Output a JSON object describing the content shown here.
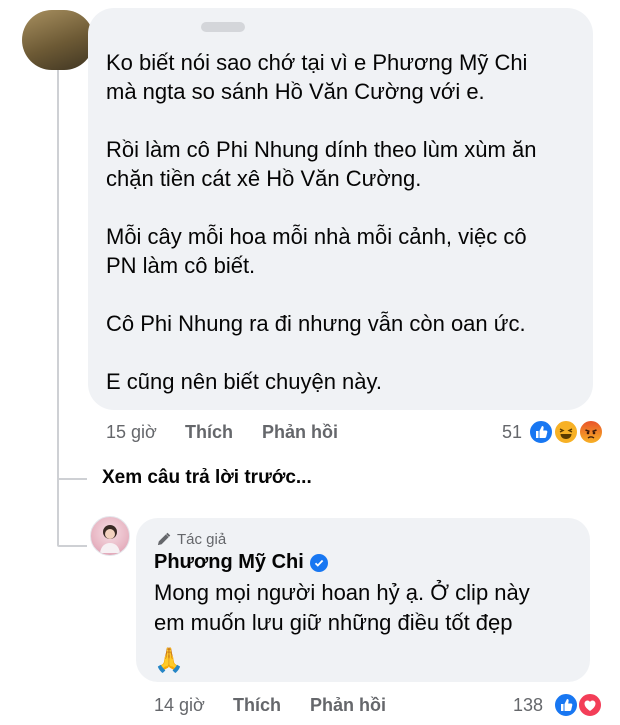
{
  "comment1": {
    "author_blurred": true,
    "paragraphs": [
      "Ko biết nói sao chớ tại vì e Phương Mỹ Chi\nmà ngta so sánh Hồ Văn Cường với e.",
      "Rồi làm cô Phi Nhung dính theo lùm xùm ăn\nchặn tiền cát xê Hồ Văn Cường.",
      "Mỗi cây mỗi hoa mỗi nhà mỗi cảnh, việc cô\nPN làm cô biết.",
      "Cô Phi Nhung ra đi nhưng vẫn còn oan ức.",
      "E cũng nên biết chuyện này."
    ],
    "time": "15 giờ",
    "like_label": "Thích",
    "reply_label": "Phản hồi",
    "reaction_count": "51",
    "reactions": [
      "like-icon",
      "haha-icon",
      "angry-icon"
    ]
  },
  "view_previous": "Xem câu trả lời trước...",
  "reply": {
    "author_badge": "Tác giả",
    "author_name": "Phương Mỹ Chi",
    "text": "Mong mọi người hoan hỷ ạ. Ở clip này\nem muốn lưu giữ những điều tốt đẹp",
    "emoji": "🙏",
    "time": "14 giờ",
    "like_label": "Thích",
    "reply_label": "Phản hồi",
    "reaction_count": "138",
    "reactions": [
      "like-icon",
      "love-icon"
    ]
  },
  "colors": {
    "bubble": "#f0f2f5",
    "secondary_text": "#65676b",
    "like_blue": "#1877f2",
    "love_red": "#f33e58",
    "haha_yellow": "#f7b125"
  }
}
